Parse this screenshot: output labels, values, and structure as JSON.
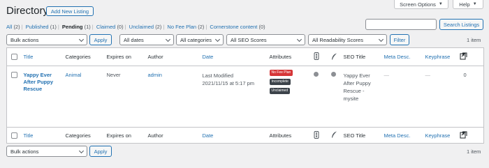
{
  "header": {
    "title": "Directory",
    "add_new": "Add New Listing",
    "screen_options": "Screen Options",
    "help": "Help"
  },
  "views": [
    {
      "label": "All",
      "count": "(2)"
    },
    {
      "label": "Published",
      "count": "(1)"
    },
    {
      "label": "Pending",
      "count": "(1)",
      "current": true
    },
    {
      "label": "Claimed",
      "count": "(0)"
    },
    {
      "label": "Unclaimed",
      "count": "(2)"
    },
    {
      "label": "No Fee Plan",
      "count": "(2)"
    },
    {
      "label": "Cornerstone content",
      "count": "(0)"
    }
  ],
  "search": {
    "value": "",
    "button": "Search Listings"
  },
  "filters": {
    "bulk_actions": "Bulk actions",
    "apply": "Apply",
    "dates": "All dates",
    "categories": "All categories",
    "seo_scores": "All SEO Scores",
    "readability": "All Readability Scores",
    "filter": "Filter",
    "items_count": "1 item"
  },
  "columns": {
    "title": "Title",
    "categories": "Categories",
    "expires": "Expires on",
    "author": "Author",
    "date": "Date",
    "attributes": "Attributes",
    "seo_title": "SEO Title",
    "meta_desc": "Meta Desc.",
    "keyphrase": "Keyphrase"
  },
  "rows": [
    {
      "title_lines": [
        "Yappy Ever",
        "After Puppy",
        "Rescue"
      ],
      "category": "Animal",
      "expires": "Never",
      "author": "admin",
      "date_status": "Last Modified",
      "date_value": "2021/11/15 at 5:17 pm",
      "badges": [
        {
          "label": "No Fee Plan",
          "color": "#d63638"
        },
        {
          "label": "Incomplete",
          "color": "#3c434a"
        },
        {
          "label": "Unclaimed",
          "color": "#3c434a"
        }
      ],
      "seo_title_lines": [
        "Yappy Ever",
        "After Puppy",
        "Rescue -",
        "mysite"
      ],
      "meta_desc": "—",
      "keyphrase": "—",
      "links_count": "0"
    }
  ],
  "bottom": {
    "bulk_actions": "Bulk actions",
    "apply": "Apply",
    "items_count": "1 item"
  },
  "colors": {
    "accent": "#2271b1",
    "danger": "#d63638",
    "dark": "#3c434a"
  },
  "icons": {
    "readability": "traffic-light-icon",
    "seo": "feather-icon",
    "links": "link-arrow-icon"
  }
}
